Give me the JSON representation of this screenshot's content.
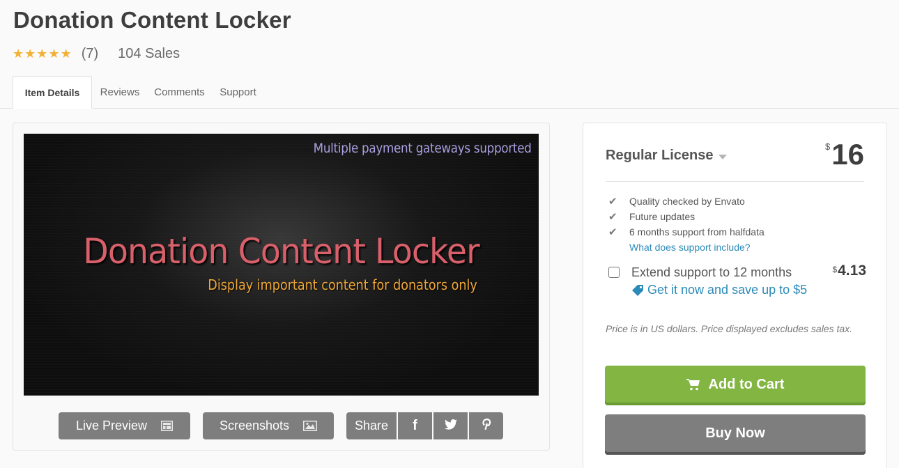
{
  "product": {
    "title": "Donation Content Locker",
    "rating_stars": 5,
    "rating_count": "(7)",
    "sales": "104 Sales"
  },
  "tabs": [
    {
      "label": "Item Details",
      "active": true
    },
    {
      "label": "Reviews",
      "active": false
    },
    {
      "label": "Comments",
      "active": false
    },
    {
      "label": "Support",
      "active": false
    }
  ],
  "preview": {
    "banner_top_text": "Multiple payment gateways supported",
    "banner_title": "Donation Content Locker",
    "banner_subtitle": "Display important content for donators only",
    "live_preview_label": "Live Preview",
    "live_preview_icon": "layout-icon",
    "screenshots_label": "Screenshots",
    "screenshots_icon": "image-icon",
    "share_label": "Share",
    "share_icons": [
      "facebook-icon",
      "twitter-icon",
      "pinterest-icon"
    ],
    "share_glyphs": [
      "f",
      "",
      "P"
    ]
  },
  "purchase": {
    "license_label": "Regular License",
    "currency_symbol": "$",
    "price": "16",
    "features": [
      "Quality checked by Envato",
      "Future updates",
      "6 months support from halfdata"
    ],
    "support_link": "What does support include?",
    "extend_label": "Extend support to 12 months",
    "extend_checked": false,
    "extend_price": "4.13",
    "save_link": "Get it now and save up to $5",
    "tax_note": "Price is in US dollars. Price displayed excludes sales tax.",
    "add_to_cart_label": "Add to Cart",
    "buy_now_label": "Buy Now"
  },
  "colors": {
    "star": "#f2b134",
    "link": "#2b8ab8",
    "add_to_cart": "#82b541",
    "grey_button": "#7e7e7e",
    "banner_title": "#d9606a",
    "banner_subtitle": "#f0a838",
    "banner_top": "#a89fe0"
  }
}
